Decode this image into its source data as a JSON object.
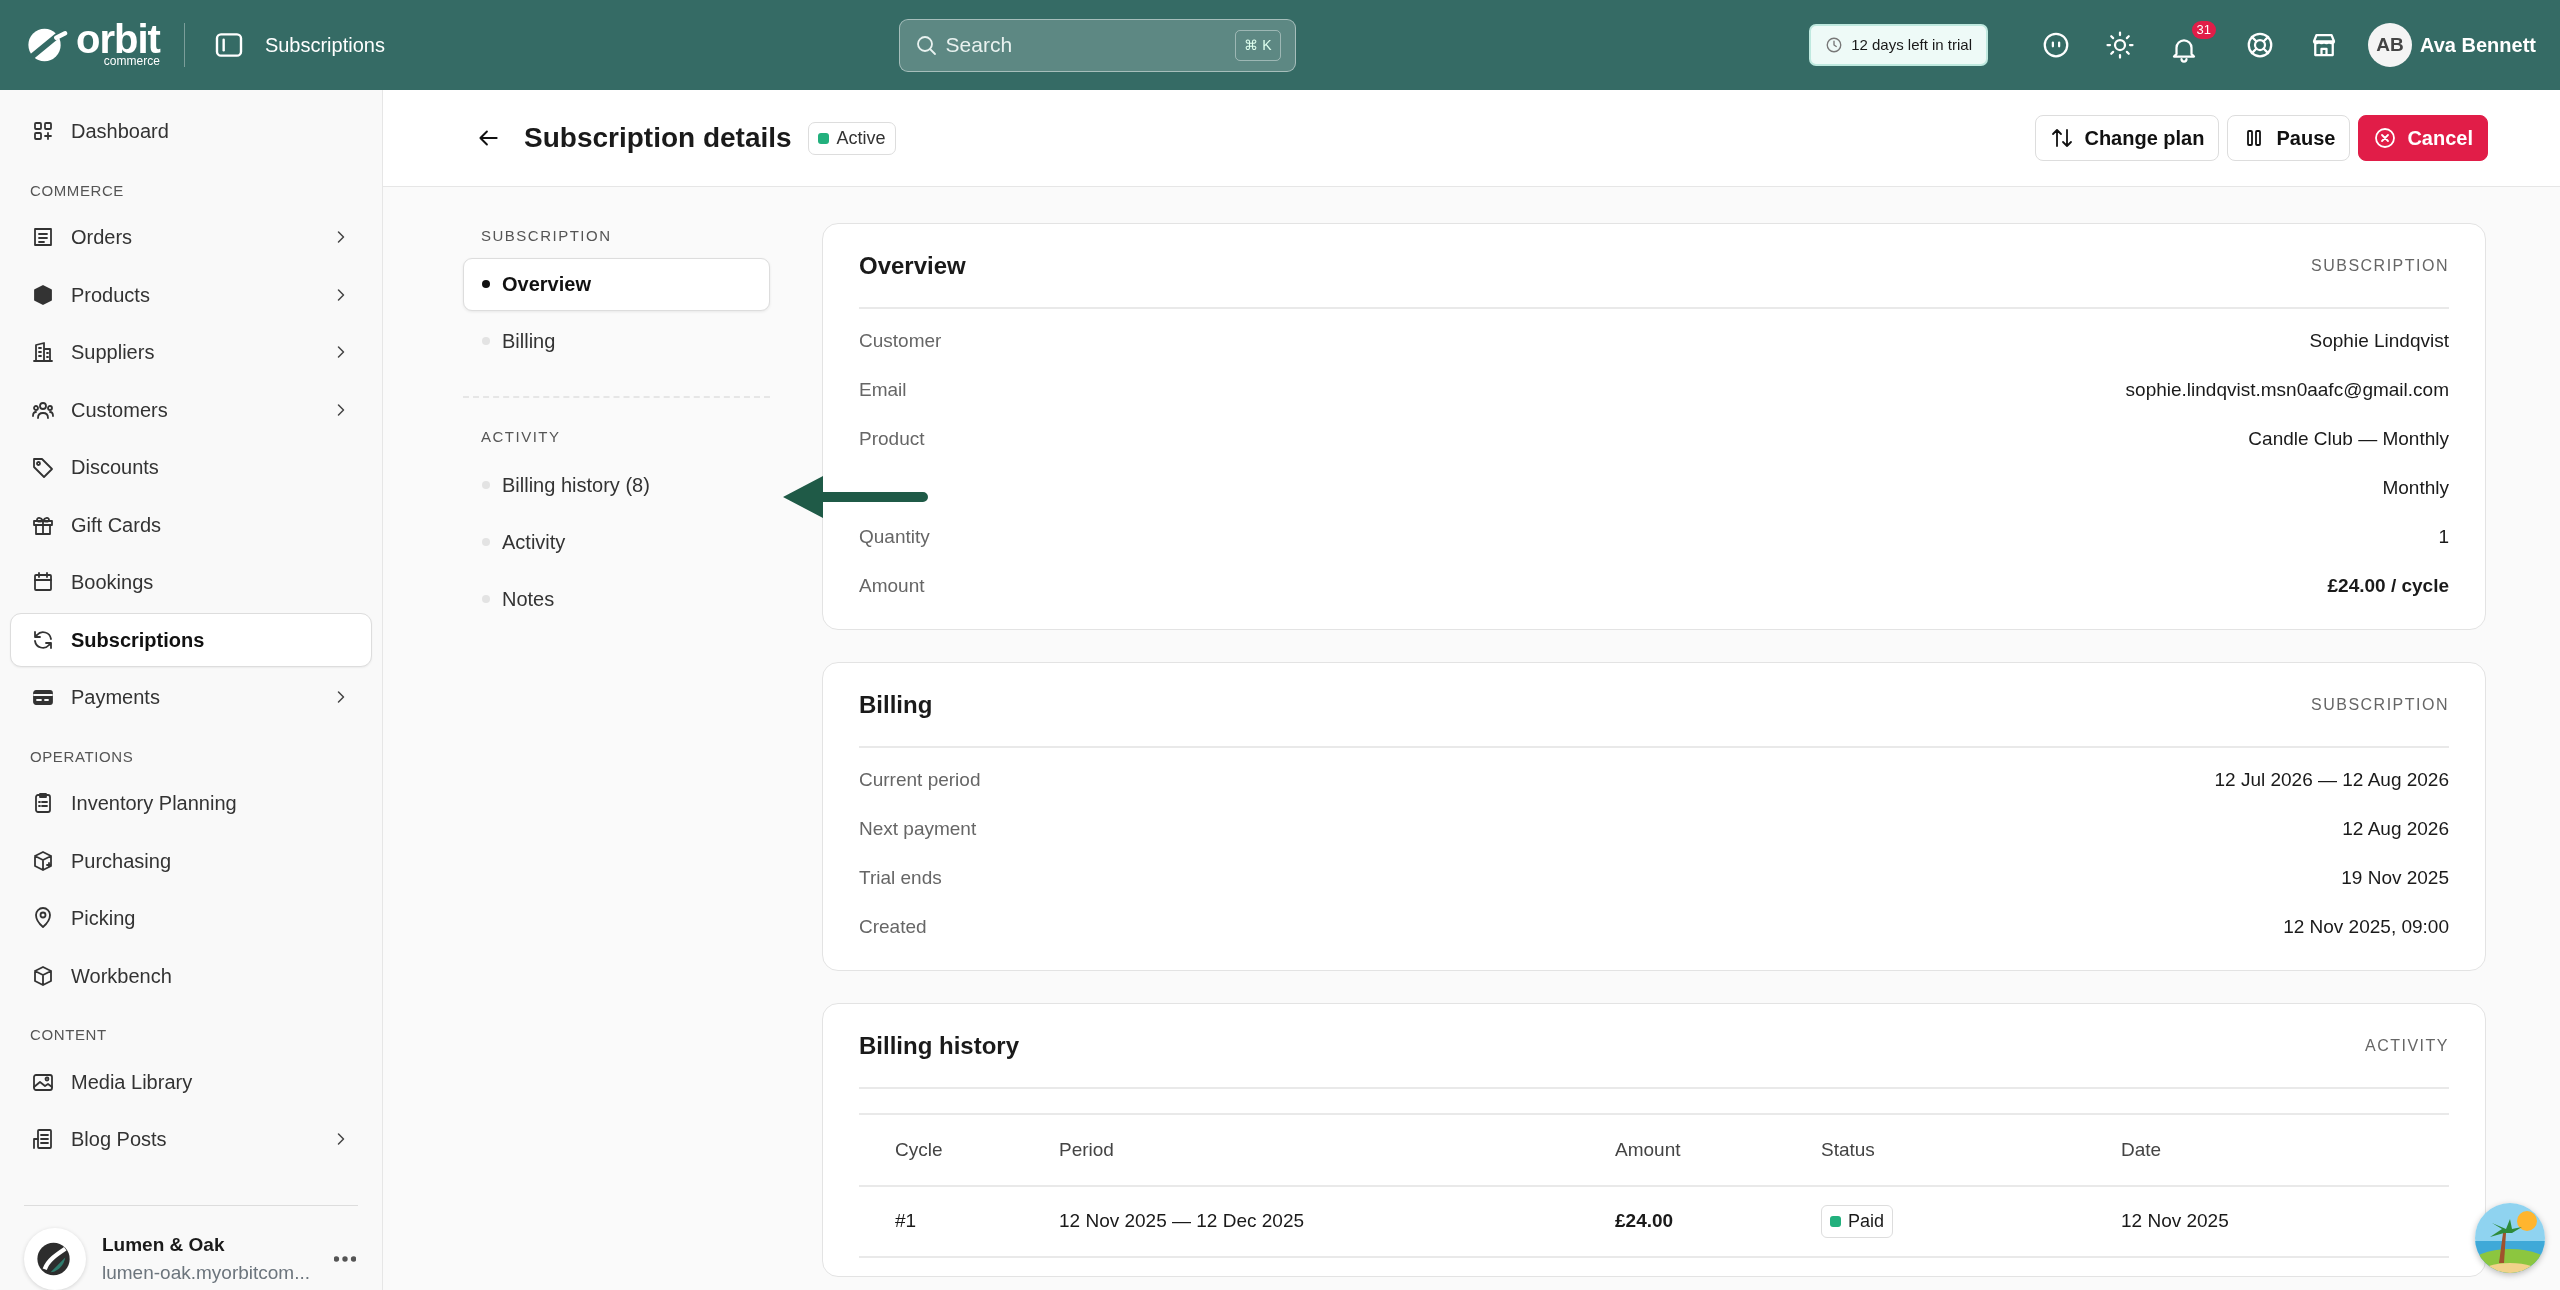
{
  "topbar": {
    "logo": {
      "name": "orbit",
      "sub": "commerce"
    },
    "page_title": "Subscriptions",
    "search": {
      "placeholder": "Search",
      "shortcut": "⌘ K"
    },
    "trial": "12 days left in trial",
    "notifications": "31",
    "user": {
      "initials": "AB",
      "name": "Ava Bennett"
    }
  },
  "sidebar": {
    "groups": [
      {
        "items": [
          {
            "label": "Dashboard",
            "expandable": false,
            "selected": false
          }
        ]
      },
      {
        "title": "COMMERCE",
        "items": [
          {
            "label": "Orders",
            "expandable": true,
            "selected": false
          },
          {
            "label": "Products",
            "expandable": true,
            "selected": false
          },
          {
            "label": "Suppliers",
            "expandable": true,
            "selected": false
          },
          {
            "label": "Customers",
            "expandable": true,
            "selected": false
          },
          {
            "label": "Discounts",
            "expandable": false,
            "selected": false
          },
          {
            "label": "Gift Cards",
            "expandable": false,
            "selected": false
          },
          {
            "label": "Bookings",
            "expandable": false,
            "selected": false
          },
          {
            "label": "Subscriptions",
            "expandable": false,
            "selected": true
          },
          {
            "label": "Payments",
            "expandable": true,
            "selected": false
          }
        ]
      },
      {
        "title": "OPERATIONS",
        "items": [
          {
            "label": "Inventory Planning",
            "expandable": false,
            "selected": false
          },
          {
            "label": "Purchasing",
            "expandable": false,
            "selected": false
          },
          {
            "label": "Picking",
            "expandable": false,
            "selected": false
          },
          {
            "label": "Workbench",
            "expandable": false,
            "selected": false
          }
        ]
      },
      {
        "title": "CONTENT",
        "items": [
          {
            "label": "Media Library",
            "expandable": false,
            "selected": false
          },
          {
            "label": "Blog Posts",
            "expandable": true,
            "selected": false
          }
        ]
      }
    ],
    "workspace": {
      "name": "Lumen & Oak",
      "url": "lumen-oak.myorbitcom..."
    }
  },
  "header": {
    "title": "Subscription details",
    "status": {
      "label": "Active",
      "color": "#22b07d"
    },
    "actions": [
      {
        "label": "Change plan",
        "kind": "swap"
      },
      {
        "label": "Pause",
        "kind": "pause"
      },
      {
        "label": "Cancel",
        "kind": "danger"
      }
    ]
  },
  "subnav": [
    {
      "title": "SUBSCRIPTION",
      "items": [
        {
          "label": "Overview",
          "selected": true
        },
        {
          "label": "Billing",
          "selected": false
        }
      ]
    },
    {
      "title": "ACTIVITY",
      "items": [
        {
          "label": "Billing history (8)",
          "selected": false
        },
        {
          "label": "Activity",
          "selected": false
        },
        {
          "label": "Notes",
          "selected": false
        }
      ]
    }
  ],
  "cards": [
    {
      "kind": "fields",
      "title": "Overview",
      "tag": "SUBSCRIPTION",
      "rows": [
        {
          "label": "Customer",
          "value": "Sophie Lindqvist",
          "emphasis": false
        },
        {
          "label": "Email",
          "value": "sophie.lindqvist.msn0aafc@gmail.com",
          "emphasis": false
        },
        {
          "label": "Product",
          "value": "Candle Club — Monthly",
          "emphasis": false
        },
        {
          "value": "Monthly",
          "emphasis": false
        },
        {
          "label": "Quantity",
          "value": "1",
          "emphasis": false
        },
        {
          "label": "Amount",
          "value": "£24.00 / cycle",
          "emphasis": true
        }
      ]
    },
    {
      "kind": "fields",
      "title": "Billing",
      "tag": "SUBSCRIPTION",
      "rows": [
        {
          "label": "Current period",
          "value": "12 Jul 2026 — 12 Aug 2026",
          "emphasis": false
        },
        {
          "label": "Next payment",
          "value": "12 Aug 2026",
          "emphasis": false
        },
        {
          "label": "Trial ends",
          "value": "19 Nov 2025",
          "emphasis": false
        },
        {
          "label": "Created",
          "value": "12 Nov 2025, 09:00",
          "emphasis": false
        }
      ]
    },
    {
      "kind": "table",
      "title": "Billing history",
      "tag": "ACTIVITY",
      "columns": [
        "Cycle",
        "Period",
        "Amount",
        "Status",
        "Date"
      ],
      "rows": [
        {
          "cycle": "#1",
          "period": "12 Nov 2025 — 12 Dec 2025",
          "amount": "£24.00",
          "status": {
            "label": "Paid",
            "color": "#22b07d"
          },
          "date": "12 Nov 2025"
        }
      ]
    }
  ]
}
